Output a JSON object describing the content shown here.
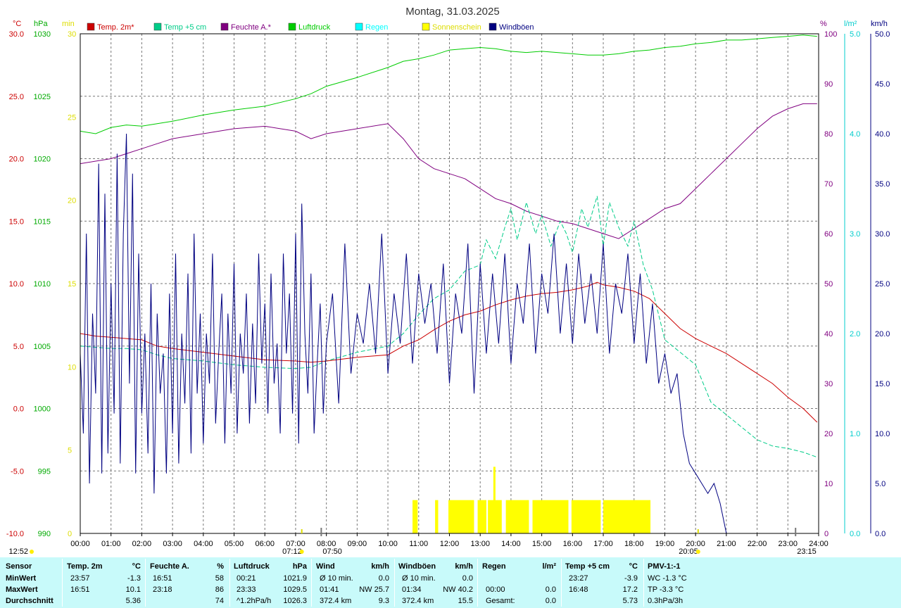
{
  "title": "Montag, 31.03.2025",
  "unit_labels": {
    "temp": "°C",
    "press": "hPa",
    "sun": "min",
    "hum": "%",
    "rain": "l/m²",
    "wind": "km/h"
  },
  "legend": [
    {
      "label": "Temp. 2m*",
      "color": "#cc0000",
      "text_color": "#cc0000"
    },
    {
      "label": "Temp +5 cm",
      "color": "#00cc88",
      "text_color": "#00cc88"
    },
    {
      "label": "Feuchte A.*",
      "color": "#800080",
      "text_color": "#800080"
    },
    {
      "label": "Luftdruck",
      "color": "#00cc00",
      "text_color": "#00cc00"
    },
    {
      "label": "Regen",
      "color": "#00ffff",
      "text_color": "#00ffff"
    },
    {
      "label": "Sonnenschein",
      "color": "#ffff00",
      "text_color": "#dddd00"
    },
    {
      "label": "Windböen",
      "color": "#000080",
      "text_color": "#000080"
    }
  ],
  "chart_data": {
    "type": "line",
    "title": "Montag, 31.03.2025",
    "x_ticks": [
      "00:00",
      "01:00",
      "02:00",
      "03:00",
      "04:00",
      "05:00",
      "06:00",
      "07:00",
      "08:00",
      "09:00",
      "10:00",
      "11:00",
      "12:00",
      "13:00",
      "14:00",
      "15:00",
      "16:00",
      "17:00",
      "18:00",
      "19:00",
      "20:00",
      "21:00",
      "22:00",
      "23:00",
      "24:00"
    ],
    "axes": {
      "temp": {
        "label": "°C",
        "min": -10,
        "max": 30,
        "ticks": [
          "30.0",
          "25.0",
          "20.0",
          "15.0",
          "10.0",
          "5.0",
          "0.0",
          "-5.0",
          "-10.0"
        ],
        "color": "#cc0000"
      },
      "press": {
        "label": "hPa",
        "min": 990,
        "max": 1030,
        "ticks": [
          "1030",
          "1025",
          "1020",
          "1015",
          "1010",
          "1005",
          "1000",
          "995",
          "990"
        ],
        "color": "#00aa00"
      },
      "sun": {
        "label": "min",
        "min": 0,
        "max": 30,
        "ticks": [
          "30",
          "25",
          "20",
          "15",
          "10",
          "5",
          "0"
        ],
        "color": "#dddd00"
      },
      "hum": {
        "label": "%",
        "min": 0,
        "max": 100,
        "ticks": [
          "100",
          "90",
          "80",
          "70",
          "60",
          "50",
          "40",
          "30",
          "20",
          "10",
          "0"
        ],
        "color": "#800080"
      },
      "rain": {
        "label": "l/m²",
        "min": 0,
        "max": 5,
        "ticks": [
          "5.0",
          "4.0",
          "3.0",
          "2.0",
          "1.0",
          "0.0"
        ],
        "color": "#00cccc"
      },
      "wind": {
        "label": "km/h",
        "min": 0,
        "max": 50,
        "ticks": [
          "50.0",
          "45.0",
          "40.0",
          "35.0",
          "30.0",
          "25.0",
          "20.0",
          "15.0",
          "10.0",
          "5.0",
          "0.0"
        ],
        "color": "#000080"
      }
    },
    "grid": true,
    "series": [
      {
        "name": "Temp. 2m*",
        "axis": "temp",
        "color": "#cc0000",
        "x": [
          0,
          0.5,
          1,
          1.5,
          2,
          2.5,
          3,
          4,
          5,
          6,
          7,
          7.5,
          8,
          9,
          10,
          10.5,
          11,
          11.5,
          12,
          12.5,
          13,
          13.5,
          14,
          14.5,
          15,
          15.5,
          16,
          16.5,
          16.8,
          17,
          17.5,
          18,
          18.5,
          19,
          19.5,
          20,
          20.5,
          21,
          21.5,
          22,
          22.5,
          23,
          23.5,
          23.95
        ],
        "y": [
          6.0,
          5.8,
          5.7,
          5.6,
          5.5,
          5.0,
          4.8,
          4.5,
          4.2,
          3.9,
          3.8,
          3.7,
          3.8,
          4.1,
          4.3,
          5.0,
          5.5,
          6.3,
          7.0,
          7.5,
          7.8,
          8.3,
          8.7,
          9.0,
          9.2,
          9.3,
          9.5,
          9.8,
          10.1,
          9.9,
          9.7,
          9.4,
          8.8,
          7.6,
          6.4,
          5.6,
          5.0,
          4.4,
          3.6,
          2.8,
          2.0,
          0.9,
          0.0,
          -1.1
        ]
      },
      {
        "name": "Temp +5 cm",
        "axis": "temp",
        "color": "#00cc88",
        "x": [
          0,
          0.5,
          1,
          1.5,
          2,
          2.5,
          3,
          4,
          5,
          6,
          7,
          7.5,
          8,
          9,
          10,
          10.5,
          11,
          11.5,
          12,
          12.5,
          13,
          13.2,
          13.5,
          13.8,
          14,
          14.2,
          14.5,
          14.8,
          15,
          15.3,
          15.6,
          15.8,
          16,
          16.3,
          16.5,
          16.8,
          17,
          17.2,
          17.5,
          17.8,
          18,
          18.3,
          18.6,
          19,
          19.5,
          20,
          20.5,
          21,
          21.5,
          22,
          22.5,
          23,
          23.5,
          23.95
        ],
        "y": [
          5.0,
          4.9,
          4.8,
          4.8,
          4.7,
          4.3,
          4.0,
          3.8,
          3.5,
          3.3,
          3.2,
          3.3,
          3.8,
          4.5,
          5.0,
          6.0,
          7.5,
          8.8,
          9.5,
          11.0,
          11.5,
          13.5,
          12.0,
          14.5,
          16.0,
          13.5,
          16.5,
          14.0,
          15.5,
          13.0,
          15.0,
          14.0,
          12.5,
          16.0,
          14.5,
          17.0,
          13.0,
          16.5,
          14.5,
          13.0,
          15.0,
          11.5,
          9.5,
          5.5,
          4.5,
          3.5,
          0.5,
          -0.5,
          -1.5,
          -2.5,
          -3.0,
          -3.2,
          -3.5,
          -3.9
        ]
      },
      {
        "name": "Feuchte A.*",
        "axis": "hum",
        "color": "#800080",
        "x": [
          0,
          0.5,
          1,
          1.5,
          2,
          2.5,
          3,
          4,
          5,
          6,
          7,
          7.5,
          8,
          9,
          10,
          10.5,
          11,
          11.5,
          12,
          12.5,
          13,
          13.5,
          14,
          14.5,
          15,
          15.5,
          16,
          16.5,
          17,
          17.5,
          18,
          18.5,
          19,
          19.5,
          20,
          20.5,
          21,
          21.5,
          22,
          22.5,
          23,
          23.5,
          23.95
        ],
        "y": [
          74,
          74.5,
          75,
          76,
          77,
          78,
          79,
          80,
          81,
          81.5,
          80.5,
          79,
          80,
          81,
          82,
          79,
          75,
          73,
          72,
          71,
          69,
          67,
          66,
          64.5,
          63.5,
          62.5,
          62,
          61,
          60,
          59,
          61,
          63,
          65,
          66,
          69,
          72,
          75,
          78,
          81,
          83.5,
          85,
          86,
          86
        ]
      },
      {
        "name": "Luftdruck",
        "axis": "press",
        "color": "#00cc00",
        "x": [
          0,
          0.5,
          1,
          1.5,
          2,
          2.5,
          3,
          4,
          5,
          6,
          7,
          7.5,
          8,
          9,
          10,
          10.5,
          11,
          11.5,
          12,
          12.5,
          13,
          13.5,
          14,
          14.5,
          15,
          15.5,
          16,
          16.5,
          17,
          17.5,
          18,
          18.5,
          19,
          19.5,
          20,
          20.5,
          21,
          21.5,
          22,
          22.5,
          23,
          23.5,
          23.95
        ],
        "y": [
          1022.2,
          1022.0,
          1022.5,
          1022.7,
          1022.6,
          1022.8,
          1023.0,
          1023.5,
          1023.9,
          1024.2,
          1024.8,
          1025.2,
          1025.8,
          1026.5,
          1027.3,
          1027.8,
          1028.0,
          1028.3,
          1028.7,
          1028.8,
          1028.9,
          1028.8,
          1028.6,
          1028.5,
          1028.6,
          1028.5,
          1028.4,
          1028.3,
          1028.3,
          1028.4,
          1028.6,
          1028.7,
          1028.9,
          1029.0,
          1029.2,
          1029.3,
          1029.5,
          1029.5,
          1029.6,
          1029.7,
          1029.8,
          1029.9,
          1029.8
        ]
      },
      {
        "name": "Windböen",
        "axis": "wind",
        "color": "#000080",
        "x": [
          0,
          0.1,
          0.2,
          0.3,
          0.4,
          0.5,
          0.6,
          0.7,
          0.8,
          0.9,
          1.0,
          1.1,
          1.2,
          1.3,
          1.4,
          1.5,
          1.6,
          1.7,
          1.8,
          1.9,
          2.0,
          2.1,
          2.2,
          2.3,
          2.4,
          2.5,
          2.6,
          2.7,
          2.8,
          2.9,
          3.0,
          3.1,
          3.2,
          3.3,
          3.4,
          3.5,
          3.6,
          3.7,
          3.8,
          3.9,
          4.0,
          4.1,
          4.2,
          4.3,
          4.4,
          4.5,
          4.6,
          4.7,
          4.8,
          4.9,
          5.0,
          5.1,
          5.2,
          5.3,
          5.4,
          5.5,
          5.6,
          5.7,
          5.8,
          5.9,
          6.0,
          6.1,
          6.2,
          6.3,
          6.4,
          6.5,
          6.6,
          6.7,
          6.8,
          6.9,
          7.0,
          7.1,
          7.2,
          7.3,
          7.4,
          7.5,
          7.6,
          7.7,
          7.8,
          7.9,
          8.0,
          8.2,
          8.4,
          8.6,
          8.8,
          9.0,
          9.2,
          9.4,
          9.6,
          9.8,
          10.0,
          10.2,
          10.4,
          10.6,
          10.8,
          11.0,
          11.2,
          11.4,
          11.6,
          11.8,
          12.0,
          12.2,
          12.4,
          12.6,
          12.8,
          13.0,
          13.2,
          13.4,
          13.6,
          13.8,
          14.0,
          14.2,
          14.4,
          14.6,
          14.8,
          15.0,
          15.2,
          15.4,
          15.6,
          15.8,
          16.0,
          16.2,
          16.4,
          16.6,
          16.8,
          17.0,
          17.2,
          17.4,
          17.6,
          17.8,
          18.0,
          18.2,
          18.4,
          18.6,
          18.8,
          19.0,
          19.2,
          19.4,
          19.6,
          19.8,
          20.0,
          20.2,
          20.4,
          20.6,
          20.8,
          21.0
        ],
        "y": [
          18,
          10,
          30,
          5,
          22,
          14,
          37,
          6,
          34,
          8,
          25,
          12,
          38,
          7,
          30,
          40,
          15,
          36,
          6,
          28,
          12,
          20,
          8,
          25,
          4,
          22,
          14,
          18,
          6,
          24,
          10,
          28,
          7,
          20,
          13,
          26,
          8,
          30,
          14,
          22,
          9,
          20,
          15,
          28,
          11,
          18,
          24,
          9,
          22,
          14,
          27,
          10,
          20,
          16,
          24,
          11,
          21,
          13,
          28,
          17,
          23,
          12,
          26,
          15,
          19,
          10,
          28,
          18,
          24,
          12,
          30,
          9,
          33,
          20,
          14,
          26,
          10,
          17,
          23,
          12,
          19,
          24,
          13,
          29,
          16,
          22,
          19,
          25,
          18,
          30,
          16,
          24,
          19,
          28,
          17,
          26,
          21,
          25,
          18,
          27,
          15,
          24,
          20,
          29,
          14,
          27,
          18,
          26,
          19,
          28,
          17,
          25,
          21,
          29,
          18,
          26,
          22,
          30,
          20,
          27,
          19,
          28,
          21,
          26,
          20,
          29,
          18,
          25,
          22,
          28,
          19,
          26,
          17,
          23,
          15,
          18,
          14,
          16,
          10,
          7,
          6,
          5,
          4,
          5,
          3,
          0
        ]
      }
    ],
    "sunshine_intervals": [
      [
        "10:48",
        "10:58"
      ],
      [
        "11:32",
        "11:38"
      ],
      [
        "11:58",
        "12:48"
      ],
      [
        "12:55",
        "13:12"
      ],
      [
        "13:15",
        "13:42"
      ],
      [
        "13:50",
        "14:35"
      ],
      [
        "14:42",
        "15:52"
      ],
      [
        "15:58",
        "16:55"
      ],
      [
        "17:00",
        "18:32"
      ]
    ],
    "sunshine_level": 2,
    "sunshine_peaks": [
      {
        "x": "13:27",
        "y": 4
      }
    ],
    "markers": {
      "bottom_labels": [
        "12:52",
        "07:12",
        "07:50",
        "20:05",
        "23:15"
      ]
    }
  },
  "stats": {
    "headers": {
      "sensor": "Sensor",
      "temp2m": "Temp. 2m",
      "temp2m_u": "°C",
      "hum": "Feuchte A.",
      "hum_u": "%",
      "press": "Luftdruck",
      "press_u": "hPa",
      "wind": "Wind",
      "wind_u": "km/h",
      "gust": "Windböen",
      "gust_u": "km/h",
      "rain": "Regen",
      "rain_u": "l/m²",
      "temp5": "Temp +5 cm",
      "temp5_u": "°C",
      "pmv": "PMV-1:-1"
    },
    "rows": [
      {
        "label": "MinWert",
        "t2_time": "23:57",
        "t2_val": "-1.3",
        "hum_time": "16:51",
        "hum_val": "58",
        "p_time": "00:21",
        "p_val": "1021.9",
        "w_time": "Ø 10 min.",
        "w_val": "0.0",
        "g_time": "Ø 10 min.",
        "g_val": "0.0",
        "r_time": "",
        "r_val": "",
        "t5_time": "23:27",
        "t5_val": "-3.9",
        "pmv": "WC -1.3 °C"
      },
      {
        "label": "MaxWert",
        "t2_time": "16:51",
        "t2_val": "10.1",
        "hum_time": "23:18",
        "hum_val": "86",
        "p_time": "23:33",
        "p_val": "1029.5",
        "w_time": "01:41",
        "w_val": "NW 25.7",
        "g_time": "01:34",
        "g_val": "NW 40.2",
        "r_time": "00:00",
        "r_val": "0.0",
        "t5_time": "16:48",
        "t5_val": "17.2",
        "pmv": "TP -3.3 °C"
      },
      {
        "label": "Durchschnitt",
        "t2_time": "",
        "t2_val": "5.36",
        "hum_time": "",
        "hum_val": "74",
        "p_time": "^1.2hPa/h",
        "p_val": "1026.3",
        "w_time": "372.4 km",
        "w_val": "9.3",
        "g_time": "372.4 km",
        "g_val": "15.5",
        "r_time": "Gesamt:",
        "r_val": "0.0",
        "t5_time": "",
        "t5_val": "5.73",
        "pmv": "0.3hPa/3h"
      }
    ]
  }
}
